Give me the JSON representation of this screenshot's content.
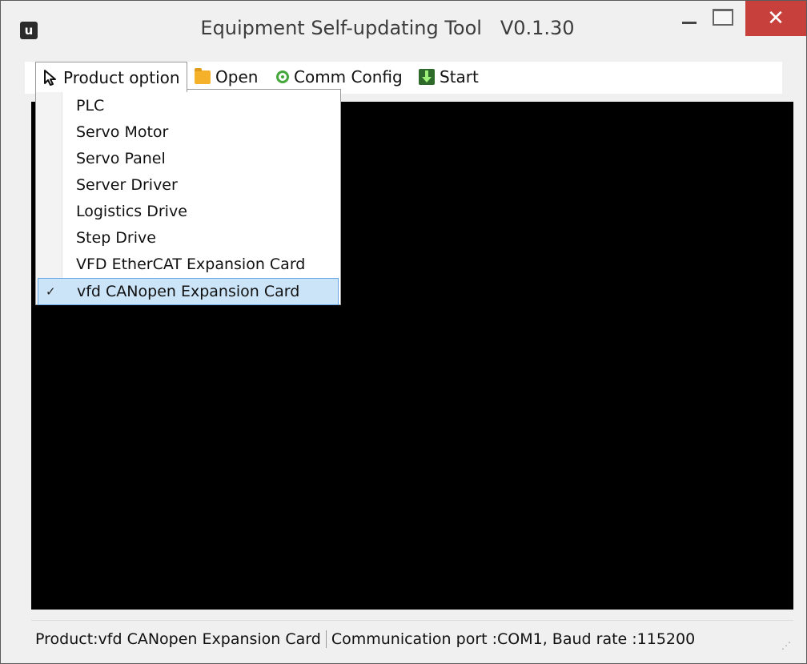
{
  "window": {
    "title": "Equipment Self-updating Tool   V0.1.30",
    "app_icon": "u",
    "close_symbol": "✕"
  },
  "menubar": {
    "product_option": "Product option",
    "open": "Open",
    "comm_config": "Comm Config",
    "start": "Start"
  },
  "product_menu": {
    "items": [
      {
        "label": "PLC",
        "checked": false
      },
      {
        "label": "Servo Motor",
        "checked": false
      },
      {
        "label": "Servo Panel",
        "checked": false
      },
      {
        "label": "Server Driver",
        "checked": false
      },
      {
        "label": "Logistics Drive",
        "checked": false
      },
      {
        "label": "Step Drive",
        "checked": false
      },
      {
        "label": "VFD EtherCAT Expansion Card",
        "checked": false
      },
      {
        "label": "vfd CANopen Expansion Card",
        "checked": true
      }
    ],
    "check_mark": "✓"
  },
  "statusbar": {
    "product": "Product:vfd CANopen Expansion Card",
    "communication": "Communication port :COM1, Baud rate :115200",
    "grip": "⋰"
  },
  "icons": {
    "pointer": "pointer-arrow-icon",
    "open": "folder-icon",
    "comm": "comm-config-icon",
    "start": "download-start-icon"
  }
}
